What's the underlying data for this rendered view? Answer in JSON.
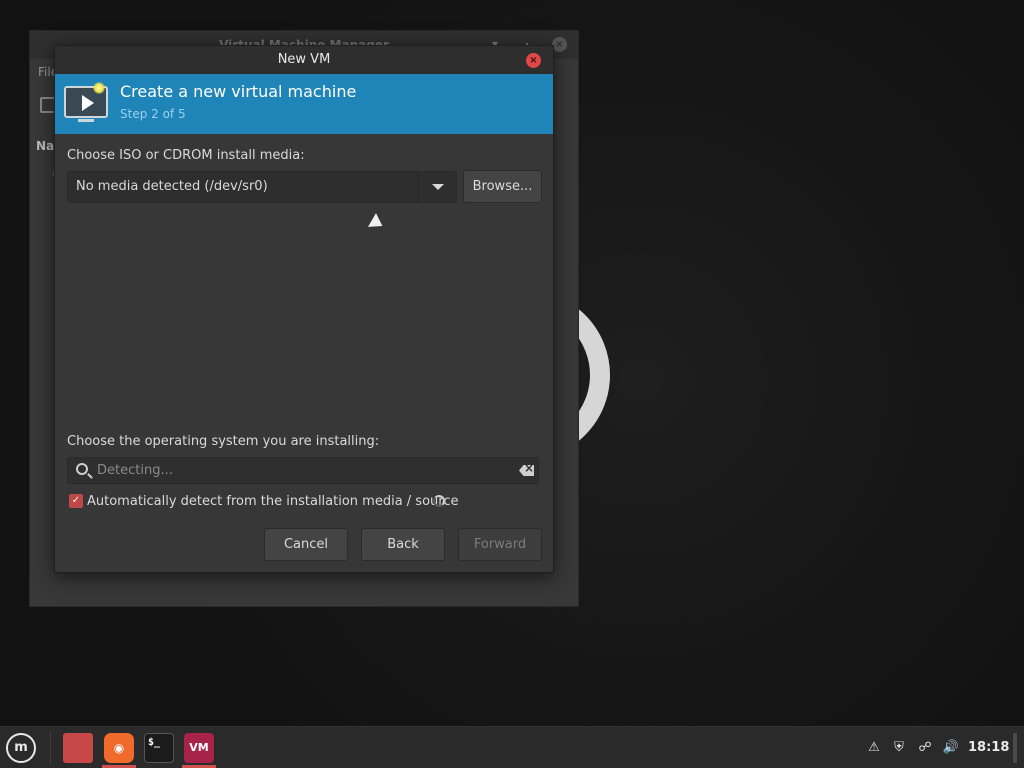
{
  "background_window": {
    "title": "Virtual Machine Manager",
    "menu_file": "File",
    "name_column": "Name",
    "min_icon": "minimize-icon",
    "max_icon": "maximize-icon",
    "close_icon": "close-icon"
  },
  "dialog": {
    "title": "New VM",
    "banner": {
      "title": "Create a new virtual machine",
      "step": "Step 2 of 5"
    },
    "media": {
      "label": "Choose ISO or CDROM install media:",
      "combo_value": "No media detected (/dev/sr0)",
      "browse_label": "Browse..."
    },
    "os": {
      "label": "Choose the operating system you are installing:",
      "search_placeholder": "Detecting...",
      "auto_detect_label": "Automatically detect from the installation media / source",
      "auto_detect_checked": true
    },
    "buttons": {
      "cancel": "Cancel",
      "back": "Back",
      "forward": "Forward"
    }
  },
  "taskbar": {
    "apps": [
      {
        "name": "files",
        "icon": "folder-icon"
      },
      {
        "name": "firefox",
        "icon": "firefox-icon"
      },
      {
        "name": "terminal",
        "icon": "terminal-icon",
        "text": "$_"
      },
      {
        "name": "virt-manager",
        "icon": "vm-icon",
        "text": "VM"
      }
    ],
    "tray": [
      "update-manager-icon",
      "shield-icon",
      "network-icon",
      "volume-icon"
    ],
    "clock": "18:18"
  },
  "colors": {
    "accent": "#1f84b8",
    "close_red": "#e04848",
    "checkbox_red": "#c04848"
  }
}
